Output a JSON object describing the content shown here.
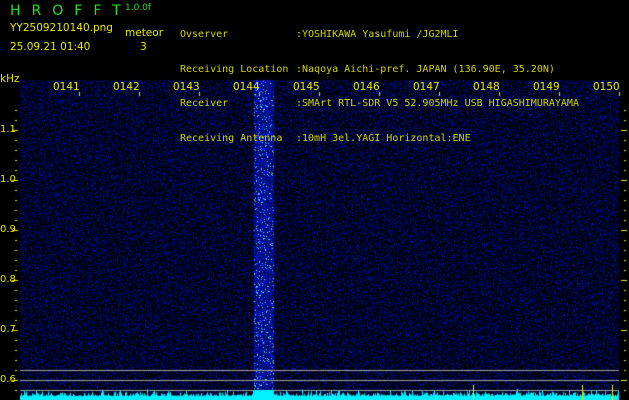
{
  "header": {
    "app_title": "HROFFT",
    "version": "1.0.0f",
    "filename": "YY2509210140.png",
    "datetime": "25.09.21 01:40",
    "meteor_label": "meteor",
    "meteor_count": "3",
    "info": [
      {
        "key": "Ovserver",
        "value": ":YOSHIKAWA Yasufumi /JG2MLI"
      },
      {
        "key": "Receiving Location",
        "value": ":Naqoya Aichi-pref. JAPAN (136.90E, 35.20N)"
      },
      {
        "key": "Receiver",
        "value": ":SMArt RTL-SDR V5 52.905MHz USB HIGASHIMURAYAMA"
      },
      {
        "key": "Receiving Antenna",
        "value": ":10mH 3el.YAGI Horizontal:ENE"
      }
    ]
  },
  "colors": {
    "title": "#22e022",
    "text": "#e8e800",
    "signal": "#2040ff",
    "baseline": "#00f0ff",
    "grid": "#a0a0a0"
  },
  "chart_data": {
    "type": "heatmap",
    "ylabel": "kHz",
    "x_ticks": [
      "0141",
      "0142",
      "0143",
      "0144",
      "0145",
      "0146",
      "0147",
      "0148",
      "0149",
      "0150"
    ],
    "y_ticks": [
      "1.1",
      "1.0",
      "0.9",
      "0.8",
      "0.7",
      "0.6"
    ],
    "ylim": [
      0.57,
      1.16
    ],
    "grid": false,
    "features": [
      {
        "time": "0144",
        "kind": "meteor echo",
        "freq_range_khz": [
          0.57,
          1.16
        ]
      }
    ]
  }
}
